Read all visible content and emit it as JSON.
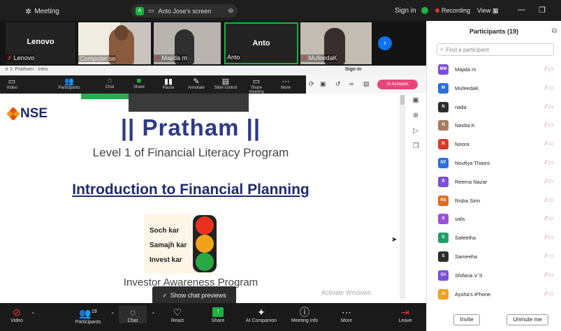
{
  "topbar": {
    "meeting_label": "Meeting",
    "screen_badge": "A",
    "screen_label": "Anto Jose's screen",
    "sign_in": "Sign in",
    "recording": "Recording",
    "view": "View"
  },
  "videos": [
    {
      "name": "Lenovo",
      "overlay": "Lenovo",
      "muted": true
    },
    {
      "name": "Computer se",
      "overlay": "",
      "muted": false
    },
    {
      "name": "Majida m",
      "overlay": "",
      "muted": true
    },
    {
      "name": "Anto",
      "overlay": "Anto",
      "muted": false,
      "active": true
    },
    {
      "name": "MufeedaK",
      "overlay": "",
      "muted": true
    }
  ],
  "shared": {
    "tab_title": "e 1: Pratham - Intro",
    "sign_in": "Sign in",
    "ai_assistant": "AI Assistant",
    "toolbar": [
      "Video",
      "Participants",
      "Chat",
      "Share",
      "Pause",
      "Annotate",
      "Slide control",
      "Share meeting",
      "More"
    ],
    "slide": {
      "logo": "NSE",
      "title": "|| Pratham ||",
      "subtitle": "Level 1 of Financial Literacy Program",
      "heading": "Introduction to Financial Planning",
      "signal_labels": [
        "Soch kar",
        "Samajh kar",
        "Invest kar"
      ],
      "footer": "Investor Awareness Program",
      "watermark": "Activate Windows"
    }
  },
  "chat_preview": "Show chat previews",
  "bottombar": {
    "video": "Video",
    "participants": "Participants",
    "participants_count": "19",
    "chat": "Chat",
    "react": "React",
    "share": "Share",
    "ai_companion": "AI Companion",
    "meeting_info": "Meeting info",
    "more": "More",
    "leave": "Leave"
  },
  "participants_panel": {
    "title": "Participants (19)",
    "search_placeholder": "Find a participant",
    "invite": "Invite",
    "unmute_me": "Unmute me",
    "people": [
      {
        "initials": "MM",
        "name": "Majida m",
        "color": "#7b4fd6"
      },
      {
        "initials": "M",
        "name": "MufeedaK",
        "color": "#2d6fdb"
      },
      {
        "initials": "N",
        "name": "nada",
        "color": "#2c2c2c"
      },
      {
        "initials": "N",
        "name": "Nasba K",
        "color": "#a67c62"
      },
      {
        "initials": "N",
        "name": "Noora",
        "color": "#d93a2b"
      },
      {
        "initials": "NT",
        "name": "Noufiya Thasni",
        "color": "#2d6fdb"
      },
      {
        "initials": "R",
        "name": "Reema Nazar",
        "color": "#7b4fd6"
      },
      {
        "initials": "RS",
        "name": "Risba Sirin",
        "color": "#e26b1f"
      },
      {
        "initials": "S",
        "name": "safa",
        "color": "#9b4fd6"
      },
      {
        "initials": "S",
        "name": "Safeetha",
        "color": "#22a06b"
      },
      {
        "initials": "S",
        "name": "Sameeha",
        "color": "#2c2c2c"
      },
      {
        "initials": "SV",
        "name": "Shifana V S",
        "color": "#7b4fd6"
      },
      {
        "initials": "AI",
        "name": "Aysha's iPhone",
        "color": "#f0a21a"
      }
    ]
  }
}
